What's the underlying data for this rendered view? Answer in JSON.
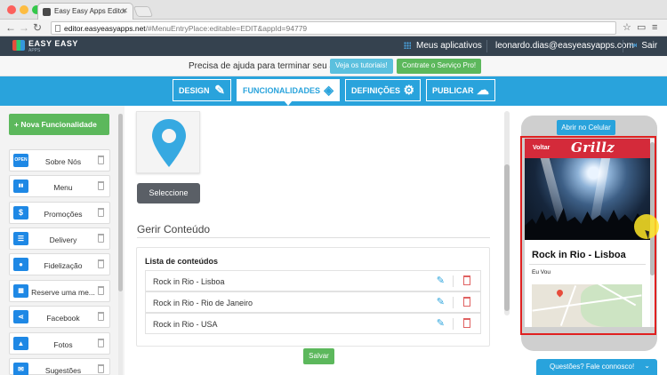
{
  "browser": {
    "tab_title": "Easy Easy Apps Editor",
    "url_host": "editor.easyeasyapps.net",
    "url_path": "/#MenuEntryPlace:editable=EDIT&appId=94779"
  },
  "header": {
    "logo": "EASY EASY",
    "logo_sub": "APPS",
    "my_apps": "Meus aplicativos",
    "email": "leonardo.dias@easyeasyapps.com",
    "logout": "Sair"
  },
  "helpbar": {
    "text": "Precisa de ajuda para terminar seu app?",
    "tutorials": "Veja os tutoriais!",
    "pro": "Contrate o Serviço Pro!"
  },
  "nav": {
    "tabs": [
      {
        "label": "DESIGN",
        "icon": "brush-icon"
      },
      {
        "label": "FUNCIONALIDADES",
        "icon": "puzzle-icon"
      },
      {
        "label": "DEFINIÇÕES",
        "icon": "gear-icon"
      },
      {
        "label": "PUBLICAR",
        "icon": "cloud-upload-icon"
      }
    ],
    "active": "FUNCIONALIDADES"
  },
  "sidebar": {
    "new_button": "+ Nova Funcionalidade",
    "items": [
      {
        "label": "Sobre Nós",
        "icon": "open-sign-icon",
        "icon_text": "OPEN"
      },
      {
        "label": "Menu",
        "icon": "book-icon"
      },
      {
        "label": "Promoções",
        "icon": "dollar-icon"
      },
      {
        "label": "Delivery",
        "icon": "clipboard-icon"
      },
      {
        "label": "Fidelização",
        "icon": "badge-icon"
      },
      {
        "label": "Reserve uma me...",
        "icon": "calendar-icon"
      },
      {
        "label": "Facebook",
        "icon": "share-icon"
      },
      {
        "label": "Fotos",
        "icon": "image-icon"
      },
      {
        "label": "Sugestões",
        "icon": "mail-icon"
      }
    ]
  },
  "main": {
    "select_button": "Seleccione",
    "section_title": "Gerir Conteúdo",
    "list_title": "Lista de conteúdos",
    "rows": [
      "Rock in Rio - Lisboa",
      "Rock in Rio - Rio de Janeiro",
      "Rock in Rio - USA"
    ],
    "save_button": "Salvar"
  },
  "preview": {
    "open_phone": "Abrir no Celular",
    "back": "Voltar",
    "brand": "Grillz",
    "title": "Rock in Rio - Lisboa",
    "subtitle": "Eu Vou"
  },
  "support": {
    "label": "Questões? Fale connosco!"
  },
  "colors": {
    "accent_blue": "#29a3dc",
    "header_dark": "#35424f",
    "green": "#5cb85c",
    "phone_red": "#d42a3a",
    "highlight_red": "#e02020"
  }
}
